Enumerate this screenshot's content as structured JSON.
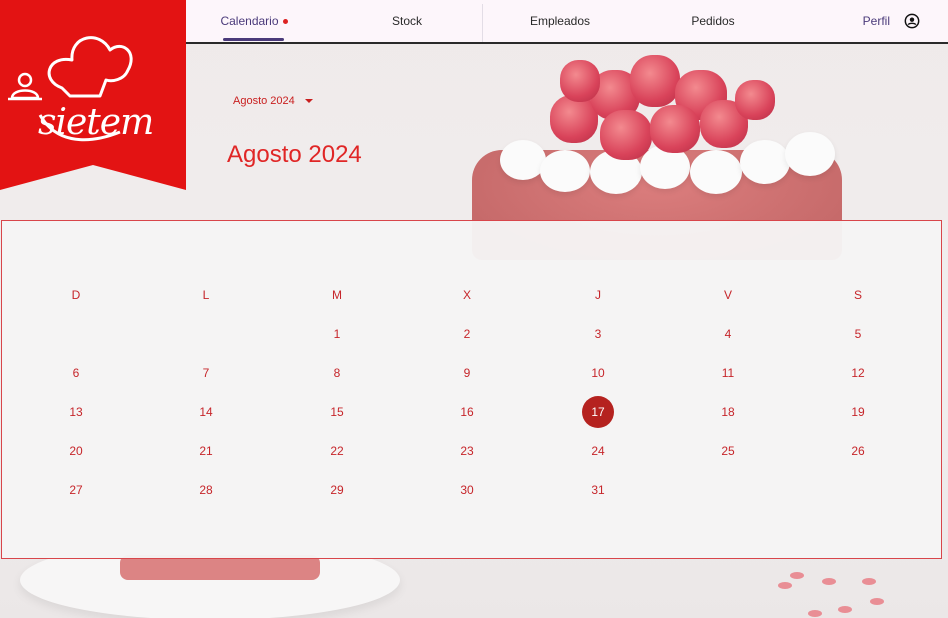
{
  "brand": {
    "name": "sietem"
  },
  "nav": {
    "items": [
      {
        "label": "Calendario",
        "active": true
      },
      {
        "label": "Stock",
        "active": false
      },
      {
        "label": "Empleados",
        "active": false
      },
      {
        "label": "Pedidos",
        "active": false
      }
    ],
    "profile_label": "Perfil",
    "profile_icon": "account-circle-icon",
    "active_dot_color": "#dd2222"
  },
  "calendar": {
    "month_select_label": "Agosto 2024",
    "title": "Agosto 2024",
    "weekday_headers": [
      "D",
      "L",
      "M",
      "X",
      "J",
      "V",
      "S"
    ],
    "weeks": [
      [
        "",
        "",
        "1",
        "2",
        "3",
        "4",
        "5"
      ],
      [
        "6",
        "7",
        "8",
        "9",
        "10",
        "11",
        "12"
      ],
      [
        "13",
        "14",
        "15",
        "16",
        "17",
        "18",
        "19"
      ],
      [
        "20",
        "21",
        "22",
        "23",
        "24",
        "25",
        "26"
      ],
      [
        "27",
        "28",
        "29",
        "30",
        "31",
        "",
        ""
      ]
    ],
    "selected_day": "17",
    "accent_color": "#c6252a",
    "selected_color": "#b5221f"
  }
}
